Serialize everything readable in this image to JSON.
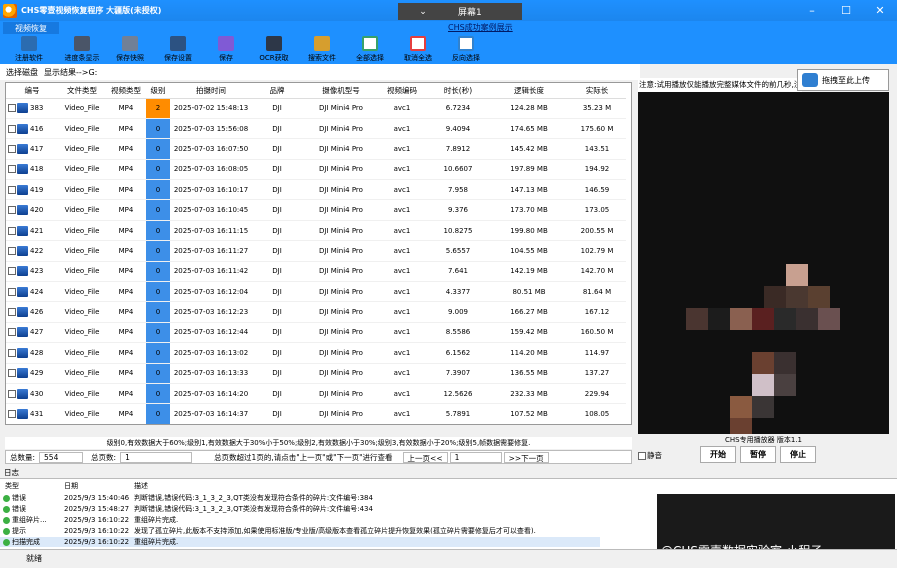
{
  "window": {
    "title": "CHS零壹视频恢复程序 大疆版(未授权)",
    "screen_selector": "屏幕1",
    "tab": "视频恢复",
    "notice_link": "CHS成功案例展示"
  },
  "toolbar": [
    {
      "label": "注册软件",
      "icon": "register-icon"
    },
    {
      "label": "进度条显示",
      "icon": "progress-icon"
    },
    {
      "label": "保存快照",
      "icon": "snapshot-icon"
    },
    {
      "label": "保存设置",
      "icon": "settings-save-icon"
    },
    {
      "label": "保存",
      "icon": "save-icon"
    },
    {
      "label": "OCR获取",
      "icon": "ocr-icon"
    },
    {
      "label": "搜索文件",
      "icon": "search-file-icon"
    },
    {
      "label": "全部选择",
      "icon": "select-all-icon"
    },
    {
      "label": "取消全选",
      "icon": "deselect-icon"
    },
    {
      "label": "反向选择",
      "icon": "invert-select-icon"
    }
  ],
  "subheader": {
    "disk_label": "选择磁盘",
    "result_label": "显示结果-->G:"
  },
  "table": {
    "columns": [
      "编号",
      "文件类型",
      "视频类型",
      "级别",
      "拍摄时间",
      "品牌",
      "摄像机型号",
      "视频编码",
      "时长(秒)",
      "逻辑长度",
      "实际长"
    ],
    "rows": [
      [
        "383",
        "Video_File",
        "MP4",
        "2",
        "2025-07-02 15:48:13",
        "DJI",
        "DJI Mini4 Pro",
        "avc1",
        "6.7234",
        "124.28 MB",
        "35.23 M"
      ],
      [
        "416",
        "Video_File",
        "MP4",
        "0",
        "2025-07-03 15:56:08",
        "DJI",
        "DJI Mini4 Pro",
        "avc1",
        "9.4094",
        "174.65 MB",
        "175.60 M"
      ],
      [
        "417",
        "Video_File",
        "MP4",
        "0",
        "2025-07-03 16:07:50",
        "DJI",
        "DJI Mini4 Pro",
        "avc1",
        "7.8912",
        "145.42 MB",
        "143.51"
      ],
      [
        "418",
        "Video_File",
        "MP4",
        "0",
        "2025-07-03 16:08:05",
        "DJI",
        "DJI Mini4 Pro",
        "avc1",
        "10.6607",
        "197.89 MB",
        "194.92"
      ],
      [
        "419",
        "Video_File",
        "MP4",
        "0",
        "2025-07-03 16:10:17",
        "DJI",
        "DJI Mini4 Pro",
        "avc1",
        "7.958",
        "147.13 MB",
        "146.59"
      ],
      [
        "420",
        "Video_File",
        "MP4",
        "0",
        "2025-07-03 16:10:45",
        "DJI",
        "DJI Mini4 Pro",
        "avc1",
        "9.376",
        "173.70 MB",
        "173.05"
      ],
      [
        "421",
        "Video_File",
        "MP4",
        "0",
        "2025-07-03 16:11:15",
        "DJI",
        "DJI Mini4 Pro",
        "avc1",
        "10.8275",
        "199.80 MB",
        "200.55 M"
      ],
      [
        "422",
        "Video_File",
        "MP4",
        "0",
        "2025-07-03 16:11:27",
        "DJI",
        "DJI Mini4 Pro",
        "avc1",
        "5.6557",
        "104.55 MB",
        "102.79 M"
      ],
      [
        "423",
        "Video_File",
        "MP4",
        "0",
        "2025-07-03 16:11:42",
        "DJI",
        "DJI Mini4 Pro",
        "avc1",
        "7.641",
        "142.19 MB",
        "142.70 M"
      ],
      [
        "424",
        "Video_File",
        "MP4",
        "0",
        "2025-07-03 16:12:04",
        "DJI",
        "DJI Mini4 Pro",
        "avc1",
        "4.3377",
        "80.51 MB",
        "81.64 M"
      ],
      [
        "426",
        "Video_File",
        "MP4",
        "0",
        "2025-07-03 16:12:23",
        "DJI",
        "DJI Mini4 Pro",
        "avc1",
        "9.009",
        "166.27 MB",
        "167.12"
      ],
      [
        "427",
        "Video_File",
        "MP4",
        "0",
        "2025-07-03 16:12:44",
        "DJI",
        "DJI Mini4 Pro",
        "avc1",
        "8.5586",
        "159.42 MB",
        "160.50 M"
      ],
      [
        "428",
        "Video_File",
        "MP4",
        "0",
        "2025-07-03 16:13:02",
        "DJI",
        "DJI Mini4 Pro",
        "avc1",
        "6.1562",
        "114.20 MB",
        "114.97"
      ],
      [
        "429",
        "Video_File",
        "MP4",
        "0",
        "2025-07-03 16:13:33",
        "DJI",
        "DJI Mini4 Pro",
        "avc1",
        "7.3907",
        "136.55 MB",
        "137.27"
      ],
      [
        "430",
        "Video_File",
        "MP4",
        "0",
        "2025-07-03 16:14:20",
        "DJI",
        "DJI Mini4 Pro",
        "avc1",
        "12.5626",
        "232.33 MB",
        "229.94"
      ],
      [
        "431",
        "Video_File",
        "MP4",
        "0",
        "2025-07-03 16:14:37",
        "DJI",
        "DJI Mini4 Pro",
        "avc1",
        "5.7891",
        "107.52 MB",
        "108.05"
      ]
    ]
  },
  "legend": "级别0,有效数据大于60%;级别1,有效数据大于30%小于50%;级别2,有效数据小于30%;级别3,有效数据小于20%;级别5,帧数据需要修复.",
  "pager": {
    "total_label": "总数量:",
    "total": "554",
    "pages_label": "总页数:",
    "pages": "1",
    "hint": "总页数超过1页的,请点击\"上一页\"或\"下一页\"进行查看",
    "prev": "上一页<<",
    "current": "1",
    "next": ">>下一页"
  },
  "right_panel": {
    "note": "注意:试用播放仅能播放完整媒体文件的前几秒,注册",
    "upload_button": "拖拽至此上传",
    "player_label": "CHS专用播放器 版本1.1",
    "mute_label": "静音",
    "start": "开始",
    "pause": "暂停",
    "stop": "停止"
  },
  "log": {
    "title": "日志",
    "columns": [
      "类型",
      "日期",
      "描述"
    ],
    "rows": [
      [
        "错误",
        "2025/9/3 15:40:46",
        "判断错误,错误代码:3_1_3_2_3,QT类没有发现符合条件的碎片:文件编号:384"
      ],
      [
        "错误",
        "2025/9/3 15:48:27",
        "判断错误,错误代码:3_1_3_2_3,QT类没有发现符合条件的碎片:文件编号:434"
      ],
      [
        "重组碎片...",
        "2025/9/3 16:10:22",
        "重组碎片完成."
      ],
      [
        "提示",
        "2025/9/3 16:10:22",
        "发现了孤立碎片,此版本不支持添加,如果使用标准版/专业版/高级版本查看孤立碎片提升恢复效果(孤立碎片需要修复后才可以查看)."
      ],
      [
        "扫描完成",
        "2025/9/3 16:10:22",
        "重组碎片完成."
      ]
    ]
  },
  "status": "就绪",
  "watermark": "CSDN @CHS零壹数据实验室-小程子"
}
